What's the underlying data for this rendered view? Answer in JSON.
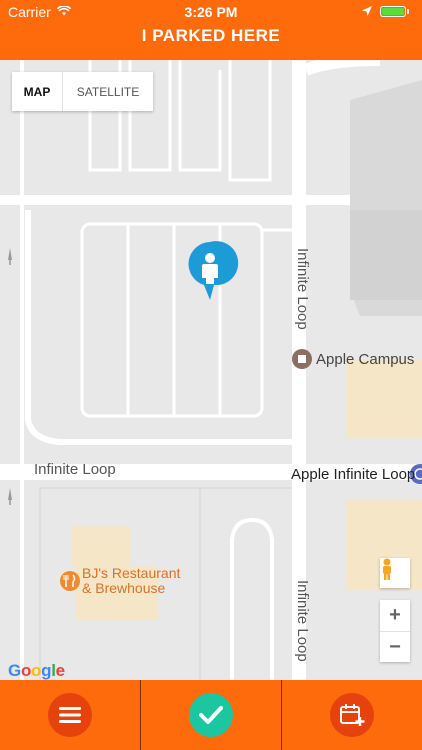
{
  "status_bar": {
    "carrier": "Carrier",
    "time": "3:26 PM"
  },
  "header": {
    "title": "I PARKED HERE"
  },
  "map": {
    "type_toggle": {
      "map_label": "MAP",
      "satellite_label": "SATELLITE"
    },
    "labels": {
      "apple_campus": "Apple Campus",
      "apple_infinite_loop": "Apple Infinite Loop",
      "infinite_loop": "Infinite Loop",
      "infinite_loop_vertical_1": "Infinite Loop",
      "infinite_loop_vertical_2": "Infinite Loop",
      "bjs_line1": "BJ's Restaurant",
      "bjs_line2": "& Brewhouse"
    },
    "zoom": {
      "in": "+",
      "out": "−"
    },
    "google_logo": [
      "G",
      "o",
      "o",
      "g",
      "l",
      "e"
    ],
    "google_logo_colors": [
      "#4285f4",
      "#ea4335",
      "#fbbc05",
      "#4285f4",
      "#34a853",
      "#ea4335"
    ]
  },
  "colors": {
    "accent": "#fd6b0d",
    "check": "#1cc6a1",
    "button_circle": "#e6420d",
    "pin": "#1d9bd6"
  },
  "icons": {
    "menu": "menu-icon",
    "check": "check-icon",
    "calendar": "calendar-add-icon",
    "pin": "person-pin-icon"
  }
}
